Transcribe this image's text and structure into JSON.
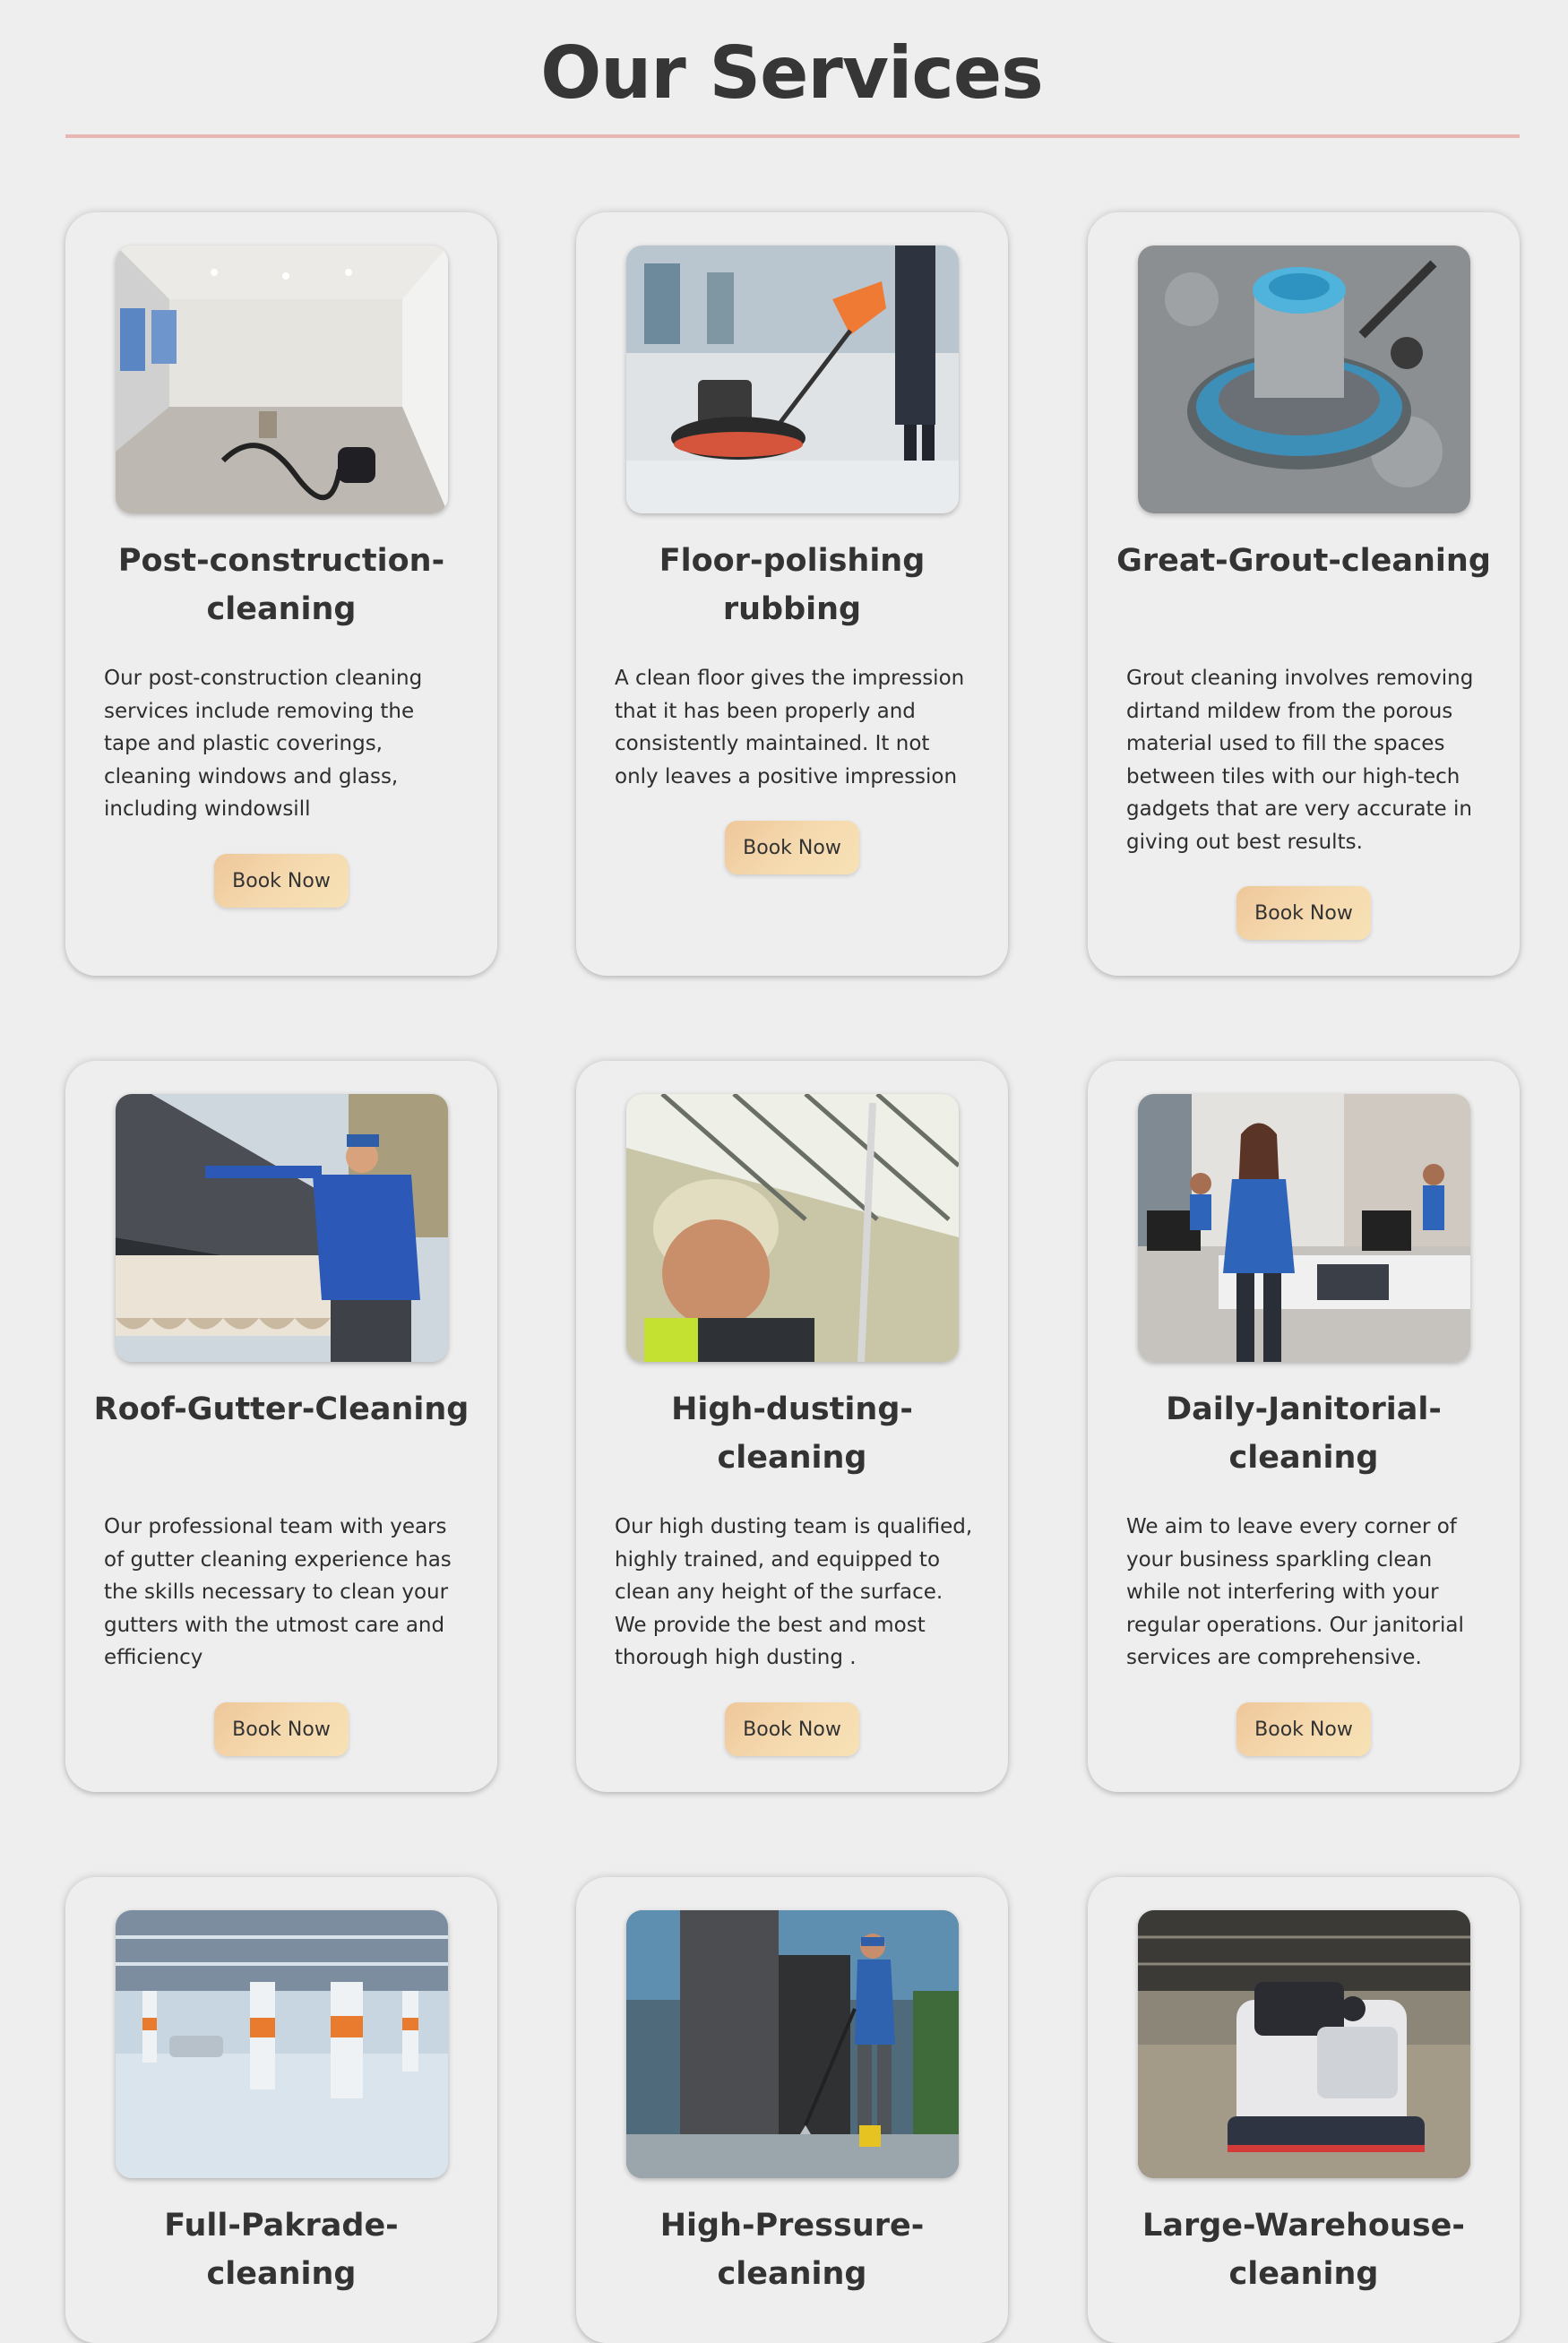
{
  "page": {
    "title": "Our Services"
  },
  "services": [
    {
      "title": "Post-construction-cleaning",
      "description": "Our post-construction cleaning services include removing the tape and plastic coverings, cleaning windows and glass, including windowsill",
      "button_label": "Book Now",
      "image_icon": "empty-room-vacuum-photo"
    },
    {
      "title": "Floor-polishing rubbing",
      "description": "A clean floor gives the impression that it has been properly and consistently maintained. It not only leaves a positive impression",
      "button_label": "Book Now",
      "image_icon": "floor-polisher-photo"
    },
    {
      "title": "Great-Grout-cleaning",
      "description": "Grout cleaning involves removing dirtand mildew from the porous material used to fill the spaces between tiles with our high-tech gadgets that are very accurate in giving out best results.",
      "button_label": "Book Now",
      "image_icon": "grout-scrubber-photo"
    },
    {
      "title": "Roof-Gutter-Cleaning",
      "description": "Our professional team with years of gutter cleaning experience has the skills necessary to clean your gutters with the utmost care and efficiency",
      "button_label": "Book Now",
      "image_icon": "gutter-worker-photo"
    },
    {
      "title": "High-dusting-cleaning",
      "description": "Our high dusting team is qualified, highly trained, and equipped to clean any height of the surface. We provide the best and most thorough high dusting .",
      "button_label": "Book Now",
      "image_icon": "high-dusting-worker-photo"
    },
    {
      "title": "Daily-Janitorial-cleaning",
      "description": "We aim to leave every corner of your business sparkling clean while not interfering with your regular operations. Our janitorial services are comprehensive.",
      "button_label": "Book Now",
      "image_icon": "office-cleaners-photo"
    },
    {
      "title": "Full-Pakrade-cleaning",
      "description": "",
      "button_label": "",
      "image_icon": "parking-garage-photo"
    },
    {
      "title": "High-Pressure-cleaning",
      "description": "",
      "button_label": "",
      "image_icon": "pressure-washer-photo"
    },
    {
      "title": "Large-Warehouse-cleaning",
      "description": "",
      "button_label": "",
      "image_icon": "warehouse-scrubber-photo"
    }
  ]
}
